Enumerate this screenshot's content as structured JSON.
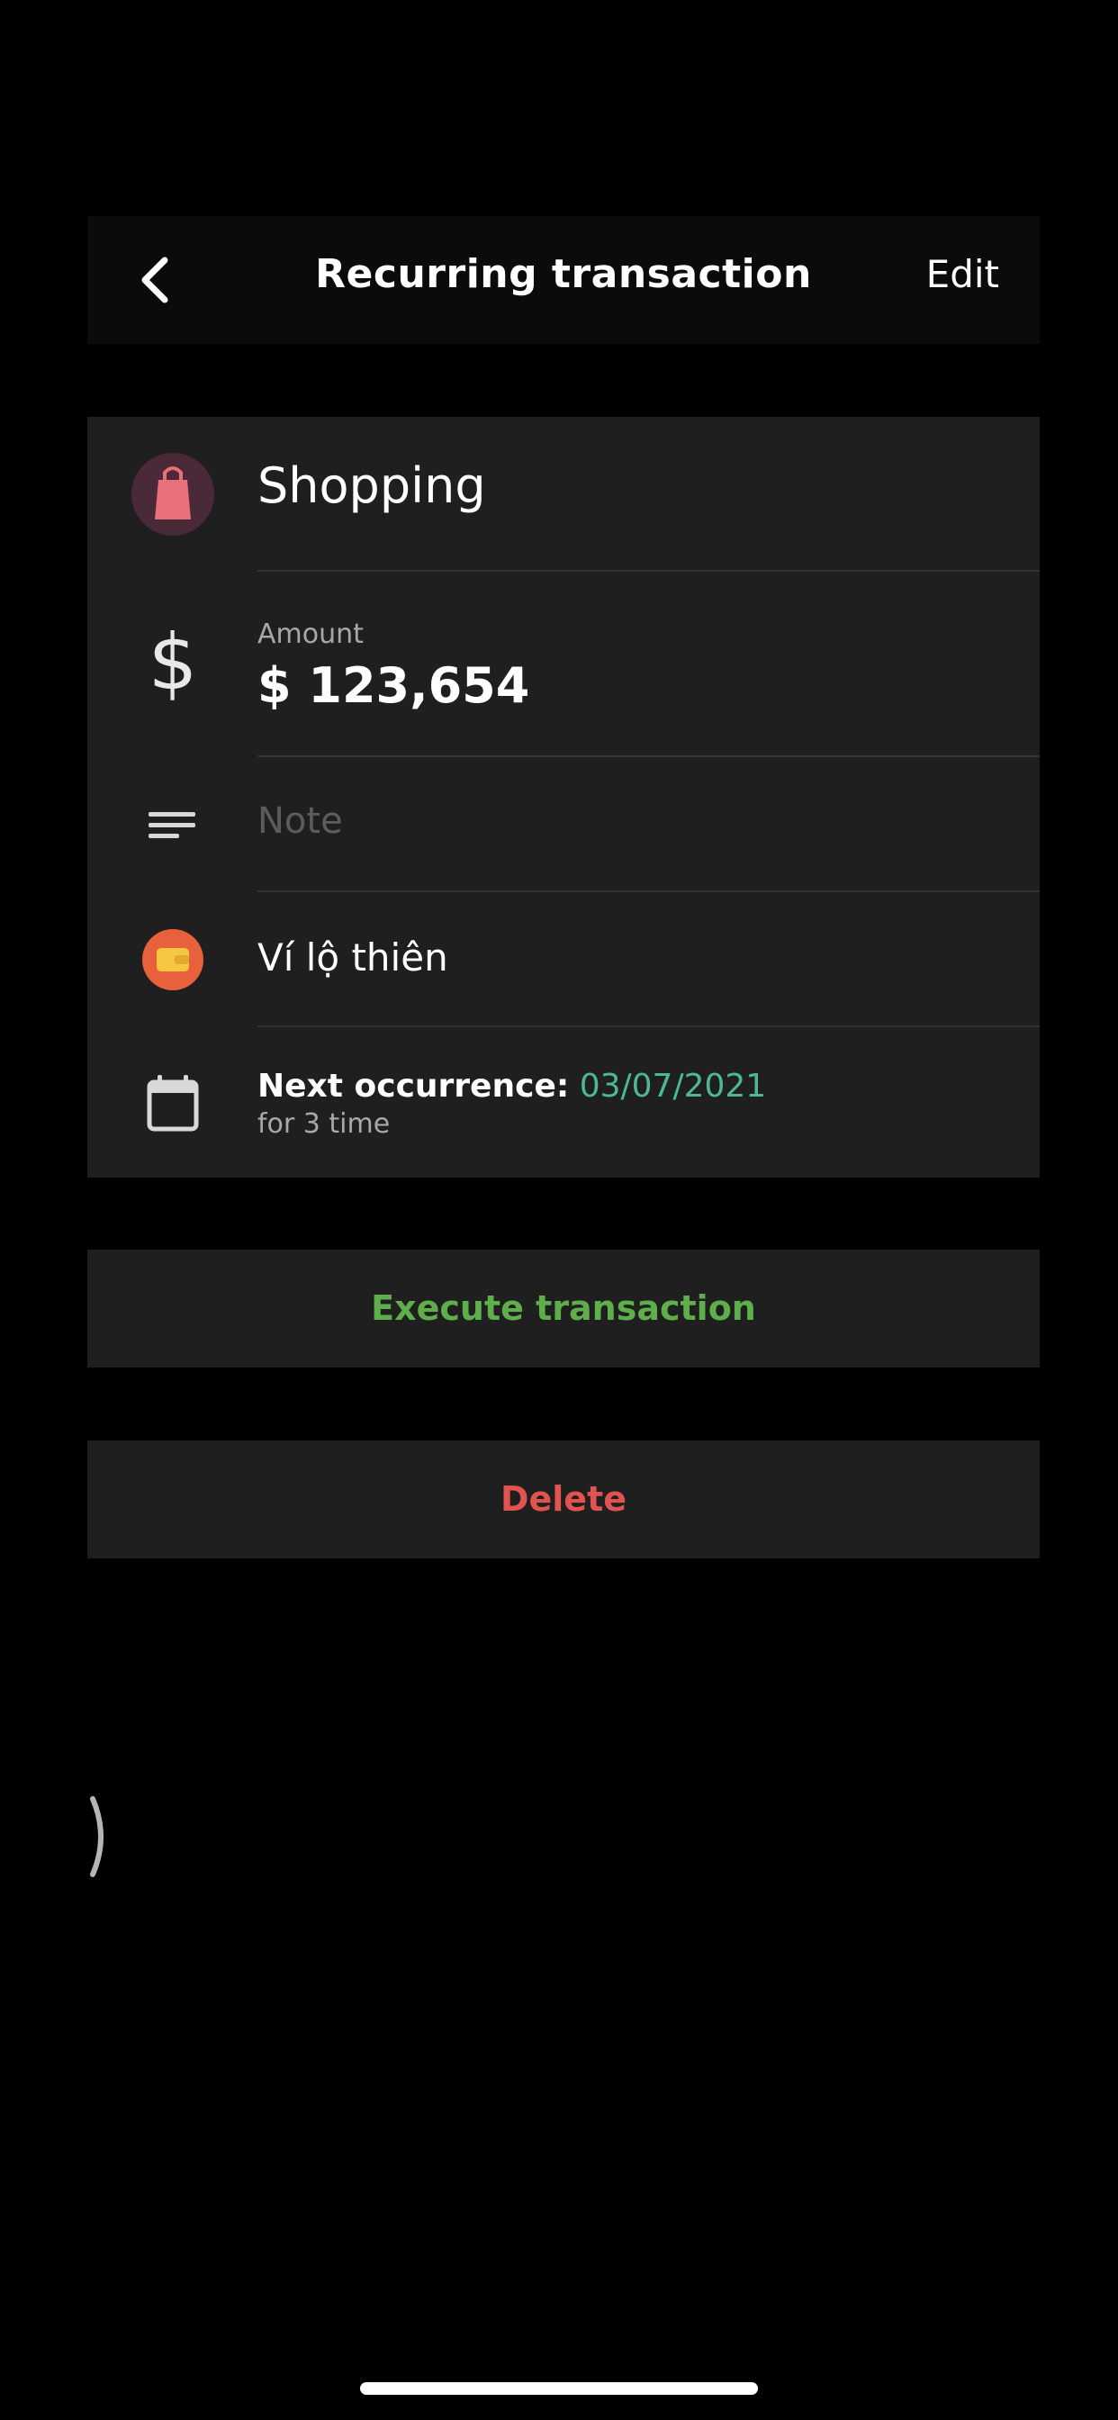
{
  "header": {
    "title": "Recurring transaction",
    "edit_label": "Edit"
  },
  "details": {
    "category": {
      "name": "Shopping",
      "icon": "shopping-bag-icon",
      "icon_color": "#e8707a"
    },
    "amount": {
      "label": "Amount",
      "value": "$ 123,654",
      "icon": "dollar-icon"
    },
    "note": {
      "placeholder": "Note",
      "icon": "note-lines-icon"
    },
    "wallet": {
      "name": "Ví lộ thiên",
      "icon": "wallet-icon",
      "icon_color": "#e8603c"
    },
    "occurrence": {
      "label": "Next occurrence:",
      "date": "03/07/2021",
      "repeat_text": "for 3 time",
      "icon": "calendar-icon"
    }
  },
  "actions": {
    "execute_label": "Execute transaction",
    "delete_label": "Delete"
  },
  "colors": {
    "background": "#000000",
    "card": "#1f1f1f",
    "accent_green": "#5fae4c",
    "date_teal": "#4db896",
    "danger_red": "#e0534f"
  }
}
